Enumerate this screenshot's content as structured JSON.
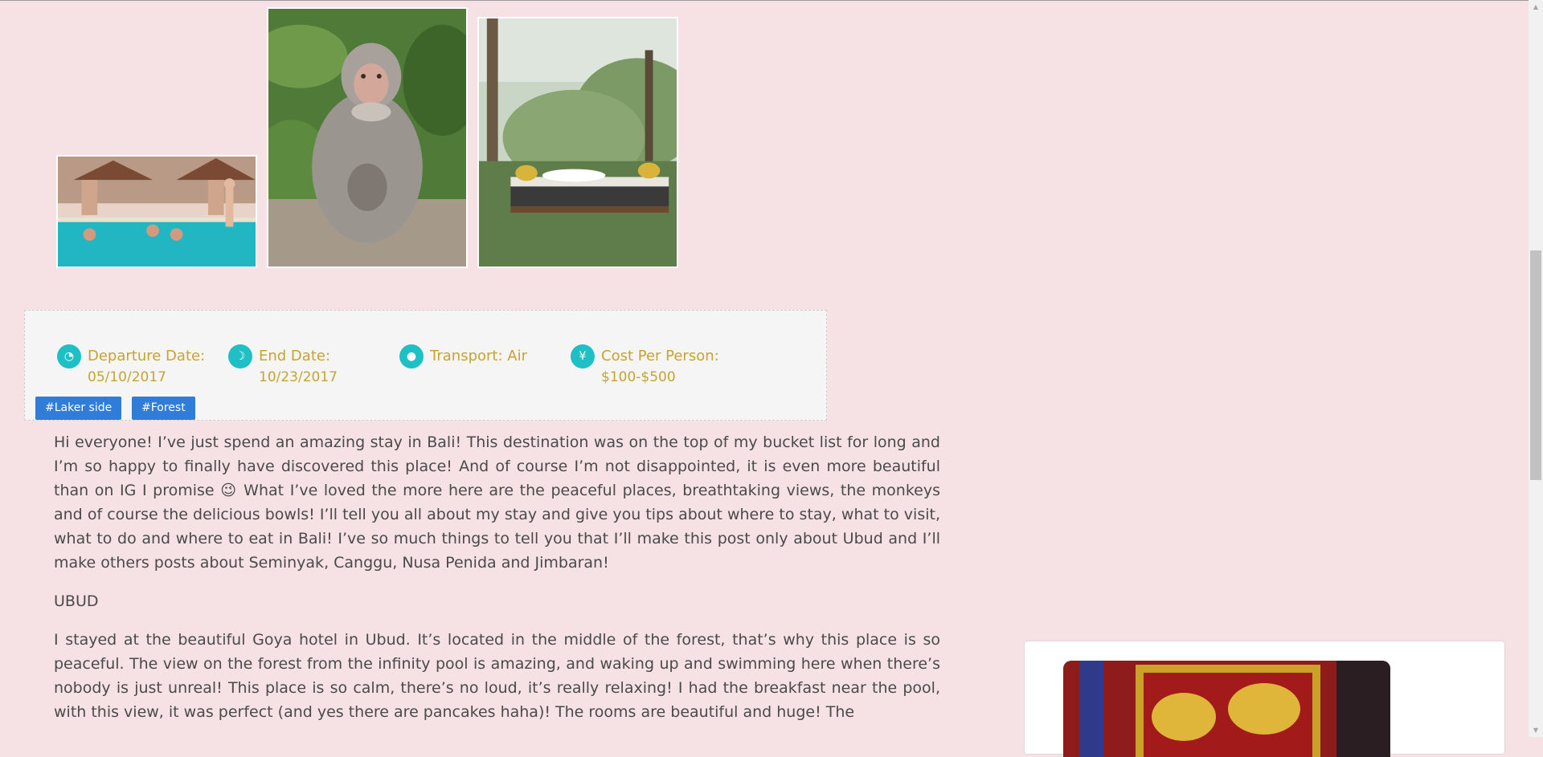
{
  "photos": [
    {
      "name": "pool-photo"
    },
    {
      "name": "monkey-photo"
    },
    {
      "name": "jungle-daybed-photo"
    }
  ],
  "trip_info": {
    "departure": {
      "icon": "clock-icon",
      "label": "Departure Date:",
      "value": "05/10/2017"
    },
    "end": {
      "icon": "moon-icon",
      "label": "End Date:",
      "value": "10/23/2017"
    },
    "transport": {
      "icon": "person-icon",
      "label": "Transport: Air"
    },
    "cost": {
      "icon": "yen-icon",
      "label": "Cost Per Person:",
      "value": "$100-$500"
    }
  },
  "tags": [
    "#Laker side",
    "#Forest"
  ],
  "article": {
    "intro": "Hi everyone! I’ve just spend an amazing stay in Bali! This destination was on the top of my bucket list for long and I’m so happy to finally have discovered this place! And of course I’m not disappointed, it is even more beautiful than on IG I promise 😉 What I’ve loved the more here are the peaceful places, breathtaking views, the monkeys and of course the delicious bowls! I’ll tell you all about my stay and give you tips about where to stay, what to visit, what to do and where to eat in Bali! I’ve so much things to tell you that I’ll make this post only about Ubud and I’ll make others posts about Seminyak, Canggu, Nusa Penida and Jimbaran!",
    "heading": "UBUD",
    "body": "I stayed at the beautiful Goya hotel in Ubud. It’s located in the middle of the forest, that’s why this place is so peaceful. The view on the forest from the infinity pool is amazing, and waking up and swimming here when there’s nobody is just unreal! This place is so calm, there’s no loud, it’s really relaxing! I had the breakfast near the pool, with this view, it was perfect (and yes there are pancakes haha)! The rooms are beautiful and huge! The"
  },
  "colors": {
    "background": "#f6e2e4",
    "accent_teal": "#1fc0c5",
    "label_gold": "#c7a332",
    "tag_blue": "#2f7cd9"
  }
}
